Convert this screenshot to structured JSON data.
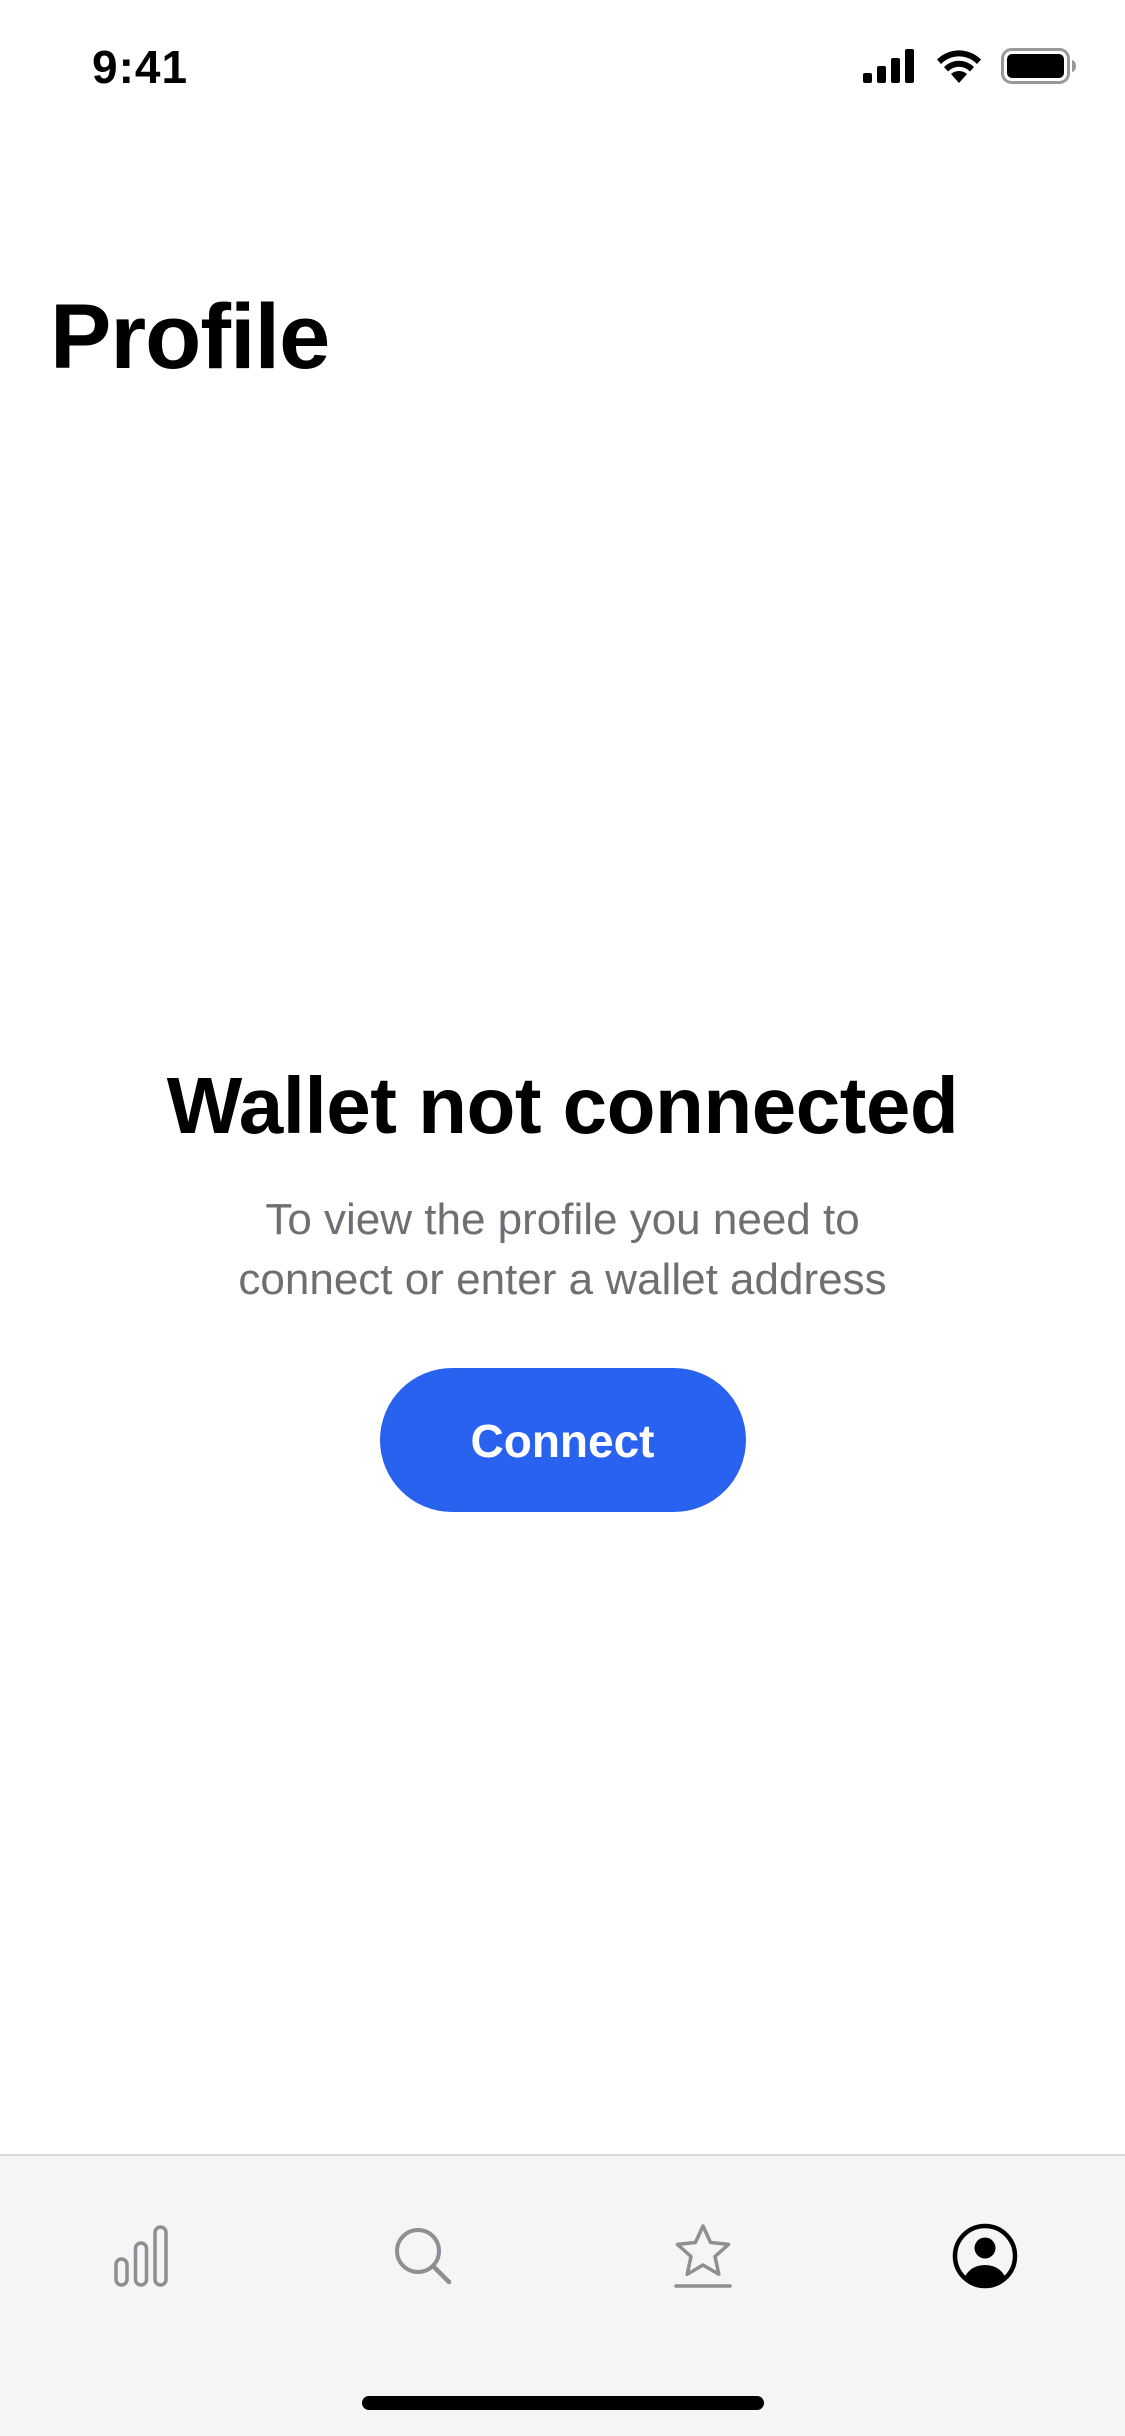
{
  "status_bar": {
    "time": "9:41",
    "icons": [
      "cellular-signal-icon",
      "wifi-icon",
      "battery-icon"
    ]
  },
  "header": {
    "title": "Profile"
  },
  "empty_state": {
    "heading": "Wallet not connected",
    "line1": "To view the profile you need to",
    "line2": "connect or enter a wallet address",
    "button_label": "Connect"
  },
  "tab_bar": {
    "items": [
      {
        "icon": "bar-chart-icon",
        "active": false
      },
      {
        "icon": "search-icon",
        "active": false
      },
      {
        "icon": "star-icon",
        "active": false
      },
      {
        "icon": "profile-icon",
        "active": true
      }
    ]
  },
  "colors": {
    "accent": "#2a62f0",
    "text_primary": "#000000",
    "text_secondary": "#6e6e73",
    "tab_inactive": "#8e8e93",
    "tab_bar_bg": "#f5f5f5"
  }
}
